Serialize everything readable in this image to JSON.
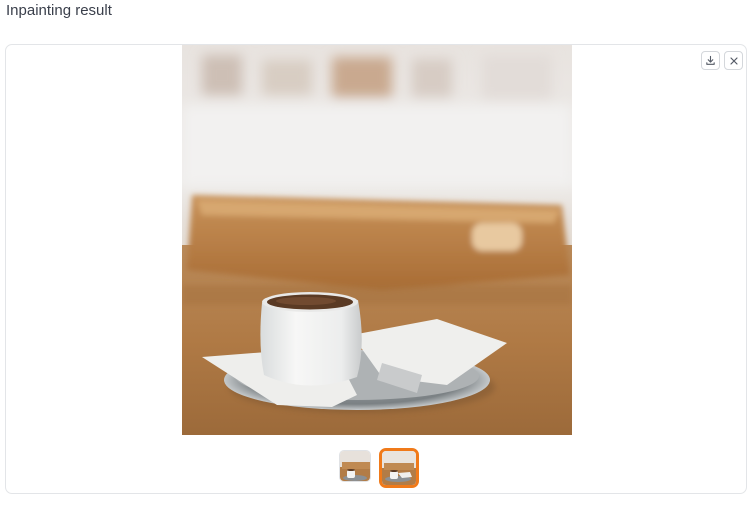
{
  "component": {
    "label": "Inpainting result"
  },
  "gallery": {
    "selected_index": 1,
    "thumbnail_count": 2,
    "image_subject": "espresso cup on saucer with napkin, wooden tray in background"
  },
  "actions": {
    "download_icon": "download-icon",
    "close_icon": "close-icon"
  },
  "colors": {
    "selected_border": "#f07a1a",
    "panel_border": "#e3e5e8",
    "label_text": "#3a3f4b"
  }
}
